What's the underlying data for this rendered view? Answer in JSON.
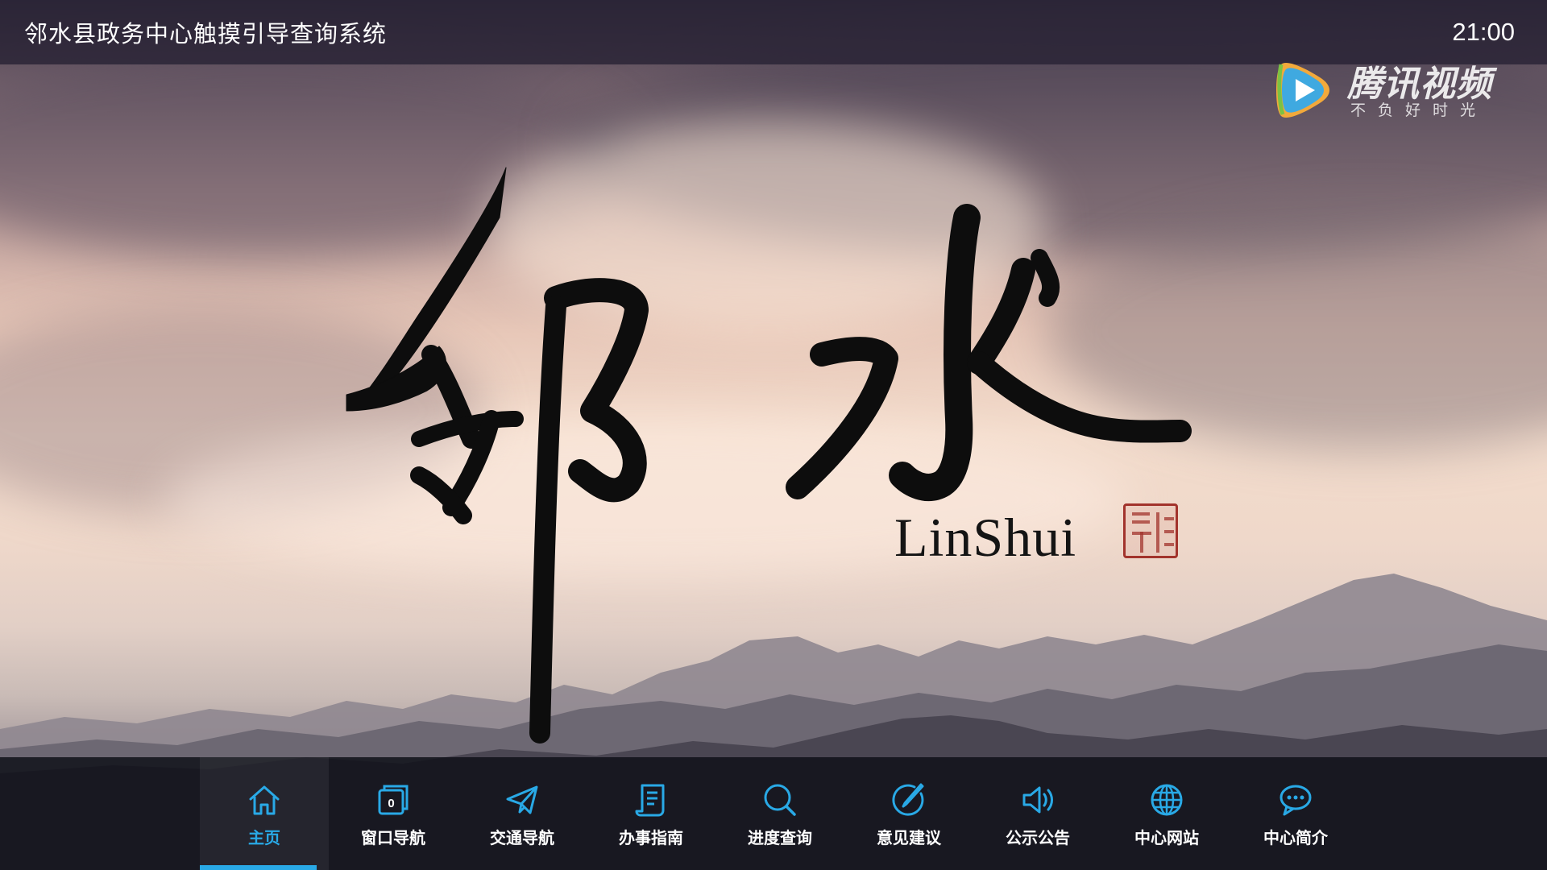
{
  "header": {
    "title": "邻水县政务中心触摸引导查询系统",
    "time": "21:00"
  },
  "hero": {
    "calligraphy_text": "邻水",
    "latin_caption": "LinShui"
  },
  "watermark": {
    "brand": "腾讯视频",
    "slogan": "不负好时光"
  },
  "colors": {
    "accent": "#29a9e6",
    "topbar": "#28223a",
    "nav_background": "#0e1018"
  },
  "nav": {
    "items": [
      {
        "label": "主页",
        "icon": "home-icon",
        "active": true
      },
      {
        "label": "窗口导航",
        "icon": "window-number-icon",
        "active": false
      },
      {
        "label": "交通导航",
        "icon": "paper-plane-icon",
        "active": false
      },
      {
        "label": "办事指南",
        "icon": "document-scroll-icon",
        "active": false
      },
      {
        "label": "进度查询",
        "icon": "search-icon",
        "active": false
      },
      {
        "label": "意见建议",
        "icon": "pen-circle-icon",
        "active": false
      },
      {
        "label": "公示公告",
        "icon": "speaker-icon",
        "active": false
      },
      {
        "label": "中心网站",
        "icon": "globe-icon",
        "active": false
      },
      {
        "label": "中心简介",
        "icon": "chat-bubble-icon",
        "active": false
      }
    ]
  }
}
